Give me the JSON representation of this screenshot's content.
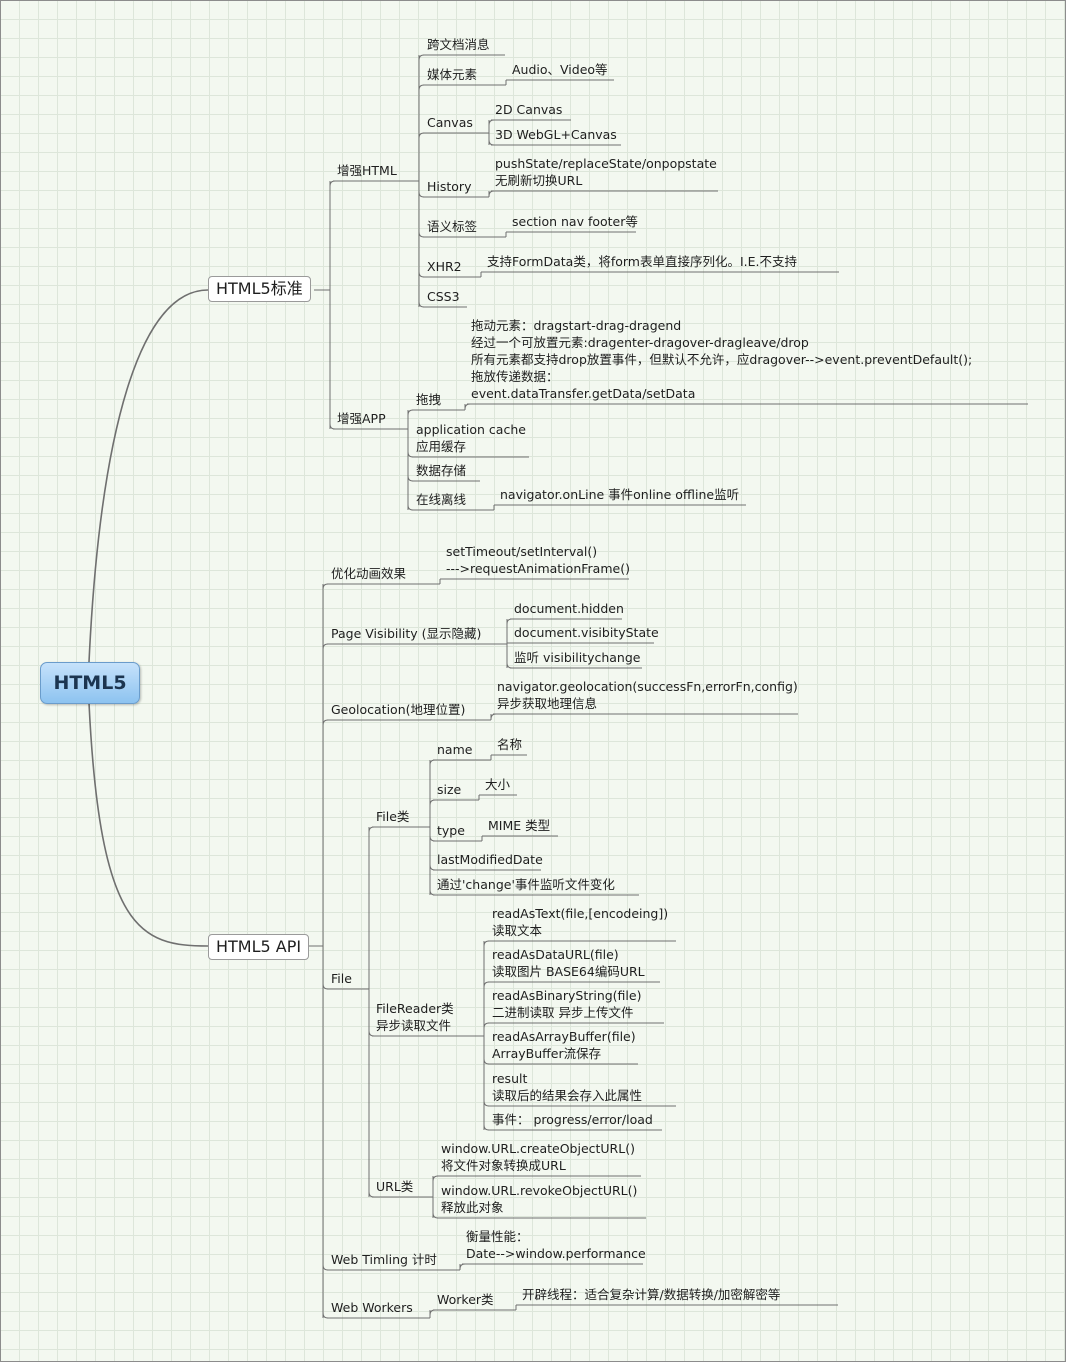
{
  "root": "HTML5",
  "branches": [
    {
      "label": "HTML5标准",
      "children": [
        {
          "label": "增强HTML",
          "children": [
            {
              "label": "跨文档消息"
            },
            {
              "label": "媒体元素",
              "children": [
                "Audio、Video等"
              ]
            },
            {
              "label": "Canvas",
              "children": [
                "2D Canvas",
                "3D WebGL+Canvas"
              ]
            },
            {
              "label": "History",
              "children": [
                [
                  "pushState/replaceState/onpopstate",
                  "无刷新切换URL"
                ]
              ]
            },
            {
              "label": "语义标签",
              "children": [
                "section nav footer等"
              ]
            },
            {
              "label": "XHR2",
              "children": [
                "支持FormData类，将form表单直接序列化。I.E.不支持"
              ]
            },
            {
              "label": "CSS3"
            }
          ]
        },
        {
          "label": "增强APP",
          "children": [
            {
              "label": "拖拽",
              "children": [
                [
                  "拖动元素：dragstart-drag-dragend",
                  "经过一个可放置元素:dragenter-dragover-dragleave/drop",
                  "所有元素都支持drop放置事件，但默认不允许，应dragover-->event.preventDefault();",
                  "拖放传递数据：",
                  "event.dataTransfer.getData/setData"
                ]
              ]
            },
            {
              "label": [
                "application cache",
                "应用缓存"
              ]
            },
            {
              "label": "数据存储"
            },
            {
              "label": "在线离线",
              "children": [
                "navigator.onLine 事件online offline监听"
              ]
            }
          ]
        }
      ]
    },
    {
      "label": "HTML5 API",
      "children": [
        {
          "label": "优化动画效果",
          "children": [
            [
              "setTimeout/setInterval()",
              "--->requestAnimationFrame()"
            ]
          ]
        },
        {
          "label": "Page Visibility (显示隐藏)",
          "children": [
            "document.hidden",
            "document.visibityState",
            "监听 visibilitychange"
          ]
        },
        {
          "label": "Geolocation(地理位置)",
          "children": [
            [
              "navigator.geolocation(successFn,errorFn,config)",
              "异步获取地理信息"
            ]
          ]
        },
        {
          "label": "File",
          "children": [
            {
              "label": "File类",
              "children": [
                {
                  "label": "name",
                  "children": [
                    "名称"
                  ]
                },
                {
                  "label": "size",
                  "children": [
                    "大小"
                  ]
                },
                {
                  "label": "type",
                  "children": [
                    "MIME 类型"
                  ]
                },
                {
                  "label": "lastModifiedDate"
                },
                {
                  "label": "通过'change'事件监听文件变化"
                }
              ]
            },
            {
              "label": [
                "FileReader类",
                "异步读取文件"
              ],
              "children": [
                [
                  "readAsText(file,[encodeing])",
                  "读取文本"
                ],
                [
                  "readAsDataURL(file)",
                  "读取图片 BASE64编码URL"
                ],
                [
                  "readAsBinaryString(file)",
                  "二进制读取 异步上传文件"
                ],
                [
                  "readAsArrayBuffer(file)",
                  "ArrayBuffer流保存"
                ],
                [
                  "result",
                  "读取后的结果会存入此属性"
                ],
                [
                  "事件： progress/error/load"
                ]
              ]
            },
            {
              "label": "URL类",
              "children": [
                [
                  "window.URL.createObjectURL()",
                  "将文件对象转换成URL"
                ],
                [
                  "window.URL.revokeObjectURL()",
                  "释放此对象"
                ]
              ]
            }
          ]
        },
        {
          "label": "Web Timling 计时",
          "children": [
            [
              "衡量性能：",
              "Date-->window.performance"
            ]
          ]
        },
        {
          "label": "Web Workers",
          "children": [
            {
              "label": "Worker类",
              "children": [
                "开辟线程：适合复杂计算/数据转换/加密解密等"
              ]
            }
          ]
        }
      ]
    }
  ]
}
